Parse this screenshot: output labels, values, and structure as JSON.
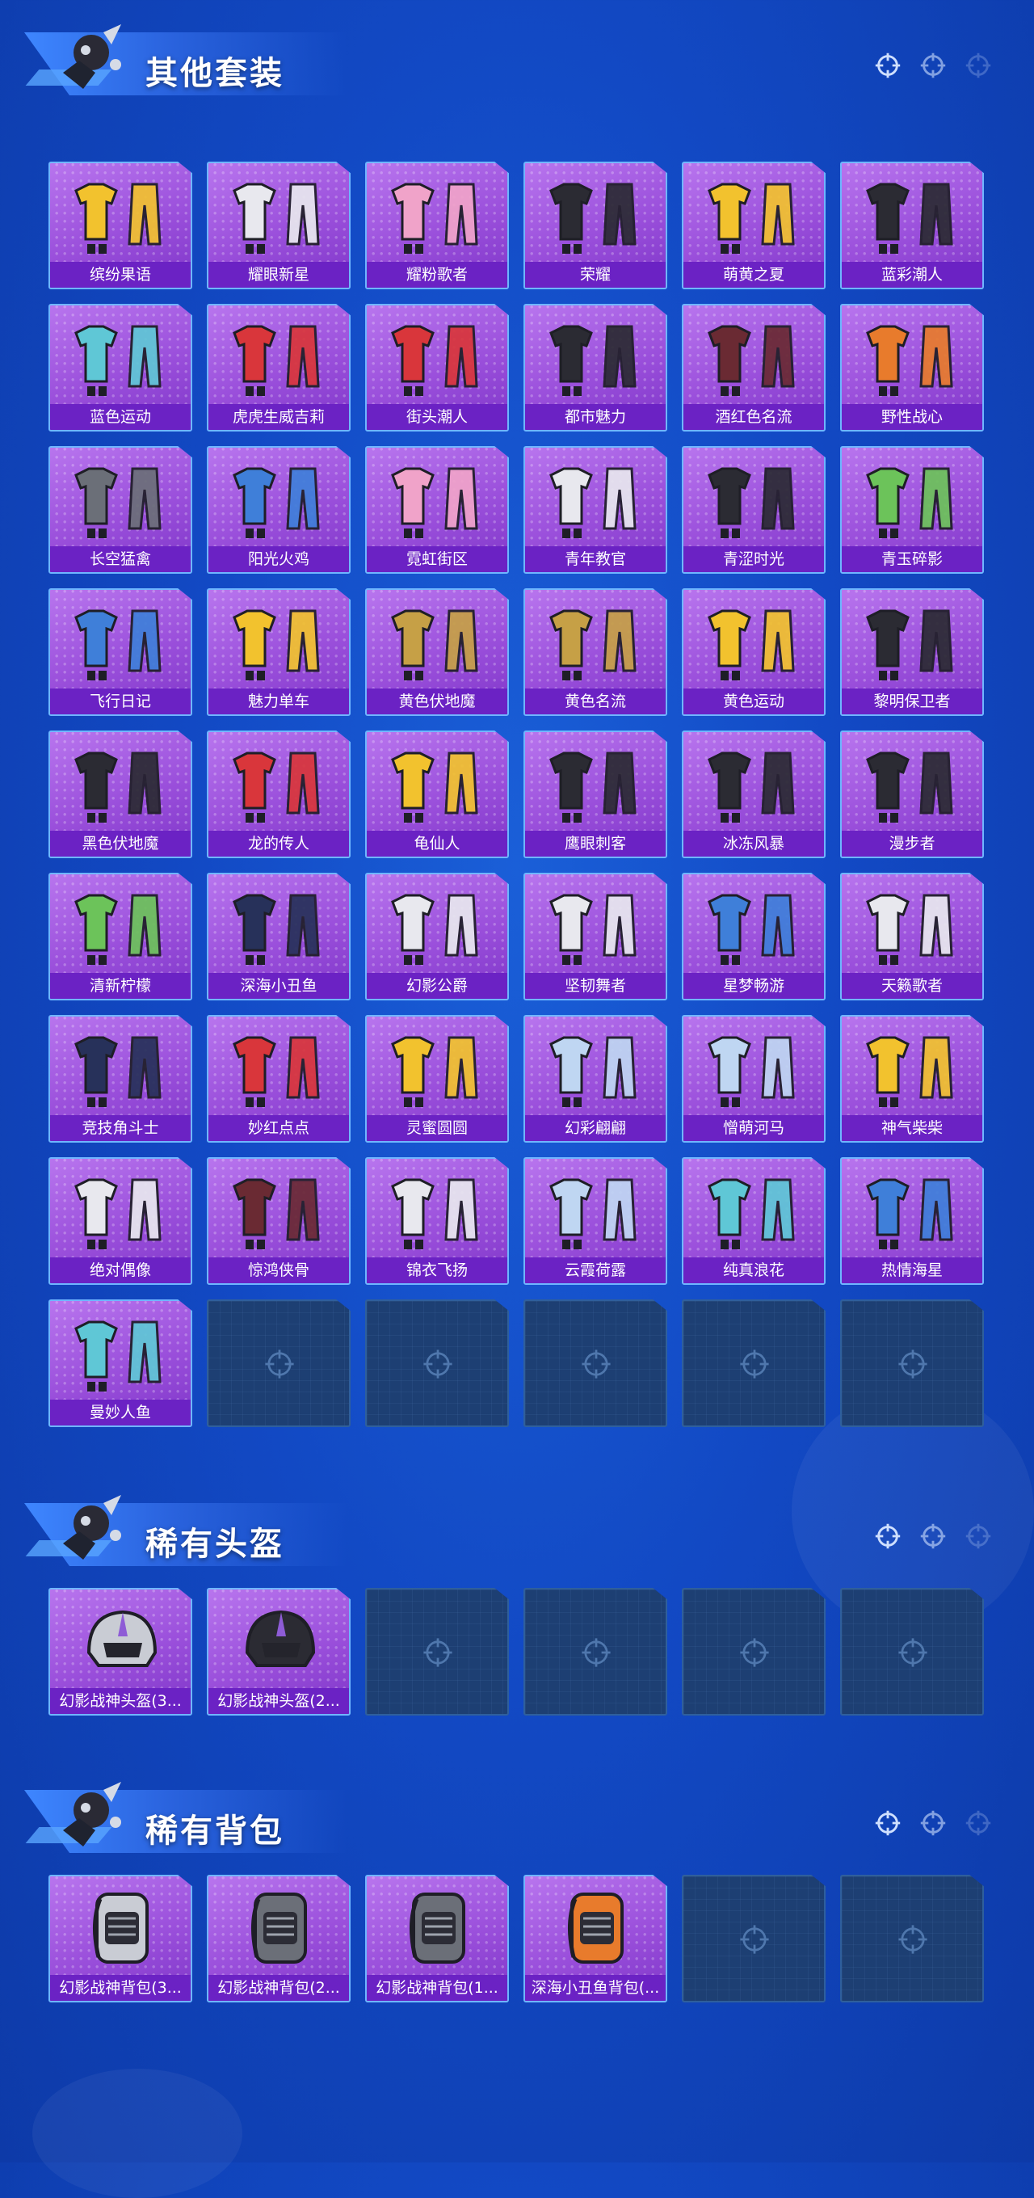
{
  "colors": {
    "page_background": "#1249c4",
    "tile_background": "#9a4fdb",
    "label_background": "#6b22c4",
    "tile_border": "#6fb6ff",
    "empty_tile": "#1d3f73"
  },
  "sections": [
    {
      "title": "其他套装",
      "items": [
        {
          "name": "缤纷果语",
          "icon": "outfit-icon",
          "art": "yellow"
        },
        {
          "name": "耀眼新星",
          "icon": "outfit-icon",
          "art": "white"
        },
        {
          "name": "耀粉歌者",
          "icon": "outfit-icon",
          "art": "pink"
        },
        {
          "name": "荣耀",
          "icon": "outfit-icon",
          "art": "black"
        },
        {
          "name": "萌黄之夏",
          "icon": "outfit-icon",
          "art": "yellow"
        },
        {
          "name": "蓝彩潮人",
          "icon": "outfit-icon",
          "art": "black"
        },
        {
          "name": "蓝色运动",
          "icon": "outfit-icon",
          "art": "teal"
        },
        {
          "name": "虎虎生威吉莉",
          "icon": "outfit-icon",
          "art": "red"
        },
        {
          "name": "街头潮人",
          "icon": "outfit-icon",
          "art": "red"
        },
        {
          "name": "都市魅力",
          "icon": "outfit-icon",
          "art": "black"
        },
        {
          "name": "酒红色名流",
          "icon": "outfit-icon",
          "art": "maroon"
        },
        {
          "name": "野性战心",
          "icon": "outfit-icon",
          "art": "orange"
        },
        {
          "name": "长空猛禽",
          "icon": "outfit-icon",
          "art": "gray"
        },
        {
          "name": "阳光火鸡",
          "icon": "outfit-icon",
          "art": "blue"
        },
        {
          "name": "霓虹街区",
          "icon": "outfit-icon",
          "art": "pink"
        },
        {
          "name": "青年教官",
          "icon": "outfit-icon",
          "art": "white"
        },
        {
          "name": "青涩时光",
          "icon": "outfit-icon",
          "art": "black"
        },
        {
          "name": "青玉碎影",
          "icon": "outfit-icon",
          "art": "green"
        },
        {
          "name": "飞行日记",
          "icon": "outfit-icon",
          "art": "blue"
        },
        {
          "name": "魅力单车",
          "icon": "outfit-icon",
          "art": "yellow"
        },
        {
          "name": "黄色伏地魔",
          "icon": "outfit-icon",
          "art": "gold"
        },
        {
          "name": "黄色名流",
          "icon": "outfit-icon",
          "art": "gold"
        },
        {
          "name": "黄色运动",
          "icon": "outfit-icon",
          "art": "yellow"
        },
        {
          "name": "黎明保卫者",
          "icon": "outfit-icon",
          "art": "black"
        },
        {
          "name": "黑色伏地魔",
          "icon": "outfit-icon",
          "art": "black"
        },
        {
          "name": "龙的传人",
          "icon": "outfit-icon",
          "art": "red"
        },
        {
          "name": "龟仙人",
          "icon": "outfit-icon",
          "art": "yellow"
        },
        {
          "name": "鹰眼刺客",
          "icon": "outfit-icon",
          "art": "black"
        },
        {
          "name": "冰冻风暴",
          "icon": "outfit-icon",
          "art": "black"
        },
        {
          "name": "漫步者",
          "icon": "outfit-icon",
          "art": "black"
        },
        {
          "name": "清新柠檬",
          "icon": "outfit-icon",
          "art": "green"
        },
        {
          "name": "深海小丑鱼",
          "icon": "outfit-icon",
          "art": "navy"
        },
        {
          "name": "幻影公爵",
          "icon": "outfit-icon",
          "art": "white"
        },
        {
          "name": "坚韧舞者",
          "icon": "outfit-icon",
          "art": "white"
        },
        {
          "name": "星梦畅游",
          "icon": "outfit-icon",
          "art": "blue"
        },
        {
          "name": "天籁歌者",
          "icon": "outfit-icon",
          "art": "white"
        },
        {
          "name": "竞技角斗士",
          "icon": "outfit-icon",
          "art": "navy"
        },
        {
          "name": "妙红点点",
          "icon": "outfit-icon",
          "art": "red"
        },
        {
          "name": "灵蜜圆圆",
          "icon": "outfit-icon",
          "art": "yellow"
        },
        {
          "name": "幻彩翩翩",
          "icon": "outfit-icon",
          "art": "pastel"
        },
        {
          "name": "憎萌河马",
          "icon": "outfit-icon",
          "art": "pastel"
        },
        {
          "name": "神气柴柴",
          "icon": "outfit-icon",
          "art": "yellow"
        },
        {
          "name": "绝对偶像",
          "icon": "outfit-icon",
          "art": "white"
        },
        {
          "name": "惊鸿侠骨",
          "icon": "outfit-icon",
          "art": "maroon"
        },
        {
          "name": "锦衣飞扬",
          "icon": "outfit-icon",
          "art": "white"
        },
        {
          "name": "云霞荷露",
          "icon": "outfit-icon",
          "art": "pastel"
        },
        {
          "name": "纯真浪花",
          "icon": "outfit-icon",
          "art": "teal"
        },
        {
          "name": "热情海星",
          "icon": "outfit-icon",
          "art": "blue"
        },
        {
          "name": "曼妙人鱼",
          "icon": "outfit-icon",
          "art": "teal"
        }
      ],
      "empty_slots": 5
    },
    {
      "title": "稀有头盔",
      "items": [
        {
          "name": "幻影战神头盔(3...",
          "icon": "helmet-icon",
          "art": "silver"
        },
        {
          "name": "幻影战神头盔(2...",
          "icon": "helmet-icon",
          "art": "black"
        }
      ],
      "empty_slots": 4
    },
    {
      "title": "稀有背包",
      "items": [
        {
          "name": "幻影战神背包(3...",
          "icon": "backpack-icon",
          "art": "silver"
        },
        {
          "name": "幻影战神背包(2...",
          "icon": "backpack-icon",
          "art": "gray"
        },
        {
          "name": "幻影战神背包(1...",
          "icon": "backpack-icon",
          "art": "gray"
        },
        {
          "name": "深海小丑鱼背包(...",
          "icon": "backpack-icon",
          "art": "orange"
        }
      ],
      "empty_slots": 2
    }
  ],
  "palette": {
    "yellow": "#f2c22e",
    "white": "#e8e8ee",
    "pink": "#f0a3c9",
    "black": "#2b2b33",
    "teal": "#5fc7d6",
    "red": "#d9363b",
    "maroon": "#6a2a33",
    "orange": "#e87b2c",
    "gray": "#6b6f78",
    "blue": "#3f7fd9",
    "green": "#6cc35a",
    "gold": "#c6a046",
    "navy": "#27315a",
    "pastel": "#bfd6f2",
    "silver": "#c9ccd4"
  }
}
